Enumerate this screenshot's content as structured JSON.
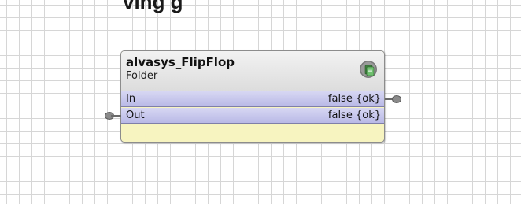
{
  "canvas": {
    "title_fragment": "ving g"
  },
  "node": {
    "name": "alvasys_FlipFlop",
    "type": "Folder",
    "icon": "folder-icon",
    "slots": [
      {
        "name": "In",
        "value": "false {ok}",
        "pin_side": "right"
      },
      {
        "name": "Out",
        "value": "false {ok}",
        "pin_side": "left"
      }
    ]
  },
  "colors": {
    "header_bg": "#dcdcdc",
    "slot_bg": "#c4c4ec",
    "body_bg": "#f7f4c0",
    "grid": "#d6d6d6",
    "icon_green": "#4a9a4a",
    "pin": "#7a7a7a"
  }
}
